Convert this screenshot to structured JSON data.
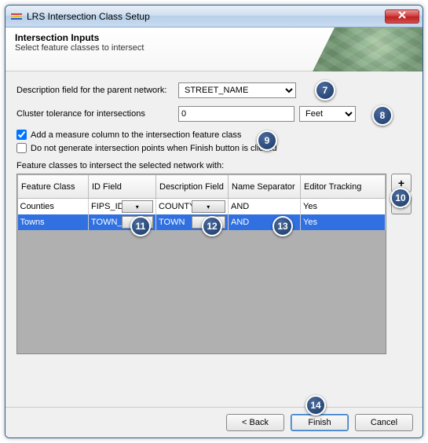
{
  "window": {
    "title": "LRS Intersection Class Setup"
  },
  "header": {
    "title": "Intersection Inputs",
    "subtitle": "Select feature classes to intersect"
  },
  "form": {
    "desc_label": "Description field for the parent network:",
    "desc_value": "STREET_NAME",
    "tol_label": "Cluster tolerance for intersections",
    "tol_value": "0",
    "tol_unit": "Feet",
    "cb_measure": "Add a measure column to the intersection feature class",
    "cb_measure_checked": true,
    "cb_nogen": "Do not generate intersection points when Finish button is clicked",
    "cb_nogen_checked": false,
    "grid_label": "Feature classes to intersect the selected network with:"
  },
  "grid": {
    "cols": [
      "Feature Class",
      "ID Field",
      "Description Field",
      "Name Separator",
      "Editor Tracking"
    ],
    "rows": [
      {
        "cls": "Counties",
        "id": "FIPS_ID",
        "desc": "COUNTY",
        "sep": "AND",
        "track": "Yes",
        "selected": false
      },
      {
        "cls": "Towns",
        "id": "TOWN_ID",
        "desc": "TOWN",
        "sep": "AND",
        "track": "Yes",
        "selected": true
      }
    ]
  },
  "buttons": {
    "add": "+",
    "remove": "✕",
    "back": "< Back",
    "finish": "Finish",
    "cancel": "Cancel"
  },
  "callouts": {
    "c7": "7",
    "c8": "8",
    "c9": "9",
    "c10": "10",
    "c11": "11",
    "c12": "12",
    "c13": "13",
    "c14": "14"
  }
}
